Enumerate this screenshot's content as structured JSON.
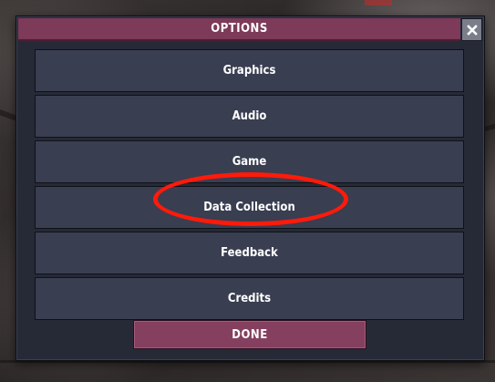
{
  "dialog": {
    "title": "OPTIONS",
    "close_icon": "close-icon",
    "menu_items": [
      {
        "label": "Graphics"
      },
      {
        "label": "Audio"
      },
      {
        "label": "Game"
      },
      {
        "label": "Data Collection"
      },
      {
        "label": "Feedback"
      },
      {
        "label": "Credits"
      }
    ],
    "done_label": "DONE",
    "highlighted_item": "Data Collection"
  },
  "colors": {
    "titlebar": "#7d3a59",
    "panel": "#262a37",
    "menu_button": "#393e51",
    "done_button": "#85405f",
    "highlight_ring": "#ff1a0a"
  }
}
